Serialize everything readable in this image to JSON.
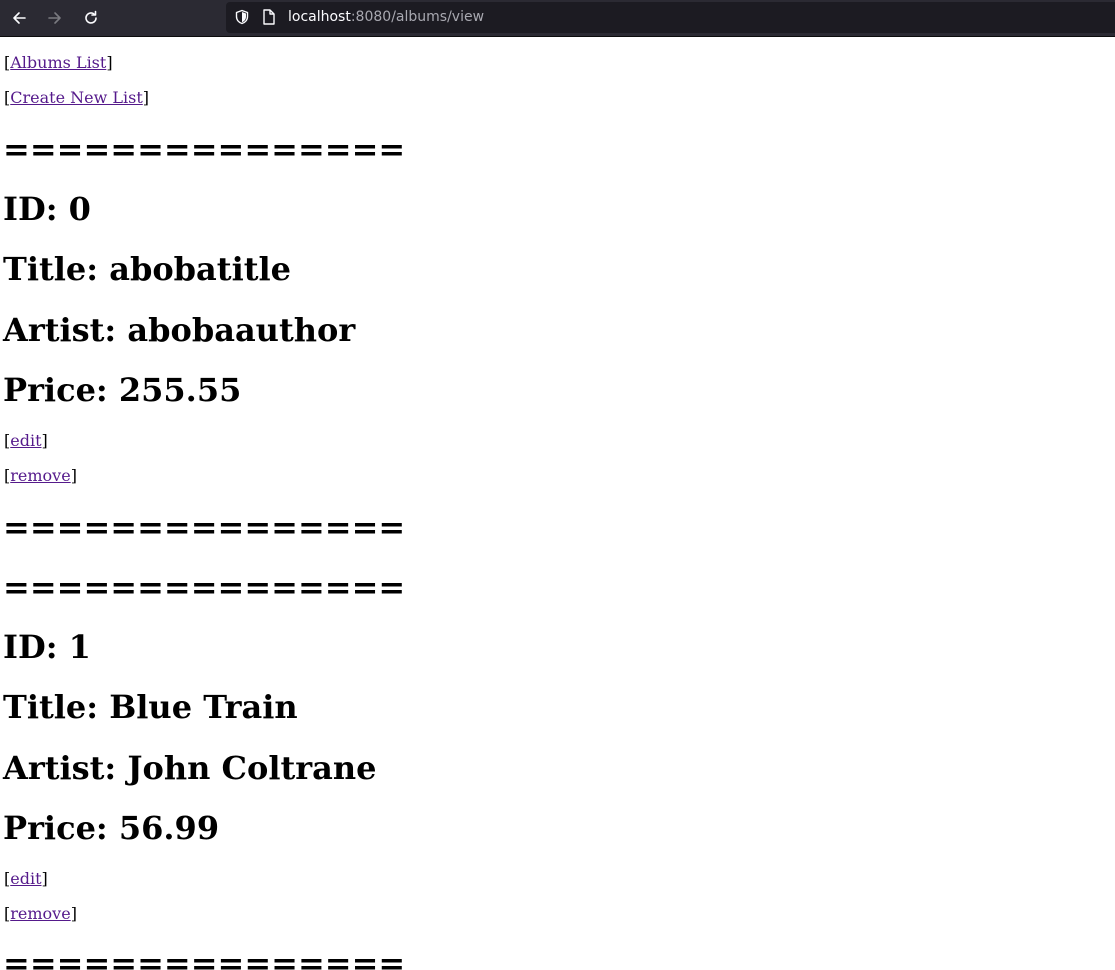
{
  "browser": {
    "url_host": "localhost",
    "url_rest": ":8080/albums/view"
  },
  "nav": {
    "albums_list": "Albums List",
    "create_new_list": "Create New List"
  },
  "separator": "===============",
  "albums": [
    {
      "id": "ID: 0",
      "title": "Title: abobatitle",
      "artist": "Artist: abobaauthor",
      "price": "Price: 255.55",
      "edit": "edit",
      "remove": "remove"
    },
    {
      "id": "ID: 1",
      "title": "Title: Blue Train",
      "artist": "Artist: John Coltrane",
      "price": "Price: 56.99",
      "edit": "edit",
      "remove": "remove"
    }
  ]
}
